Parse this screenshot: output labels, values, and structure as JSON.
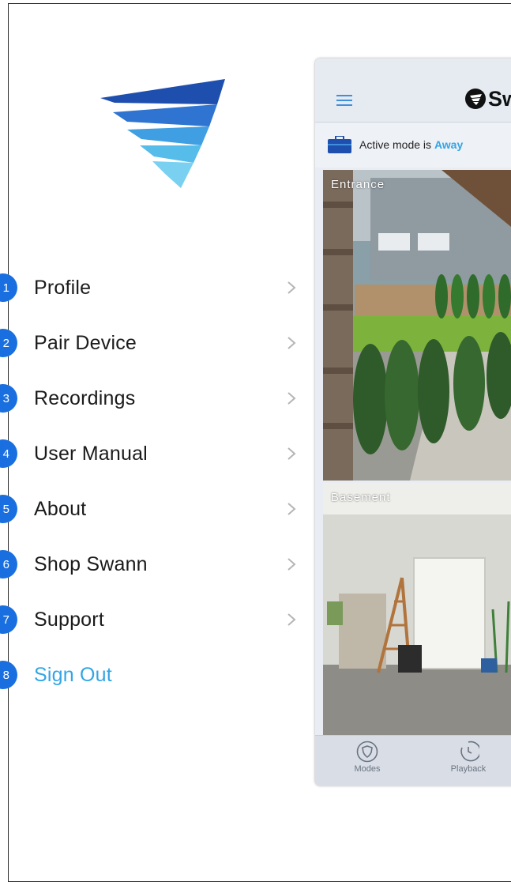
{
  "menu": {
    "items": [
      {
        "num": "1",
        "label": "Profile"
      },
      {
        "num": "2",
        "label": "Pair Device"
      },
      {
        "num": "3",
        "label": "Recordings"
      },
      {
        "num": "4",
        "label": "User Manual"
      },
      {
        "num": "5",
        "label": "About"
      },
      {
        "num": "6",
        "label": "Shop Swann"
      },
      {
        "num": "7",
        "label": "Support"
      }
    ],
    "sign_out": {
      "num": "8",
      "label": "Sign Out"
    }
  },
  "app": {
    "brand": "Sw",
    "mode": {
      "prefix": "Active mode is ",
      "value": "Away"
    },
    "cameras": [
      {
        "label": "Entrance"
      },
      {
        "label": "Basement"
      }
    ],
    "tabs": [
      {
        "label": "Modes",
        "icon": "shield-icon"
      },
      {
        "label": "Playback",
        "icon": "clock-icon"
      }
    ]
  },
  "colors": {
    "badge": "#1a6fe0",
    "accent": "#33a5e6",
    "mode_value": "#33a5e6"
  }
}
